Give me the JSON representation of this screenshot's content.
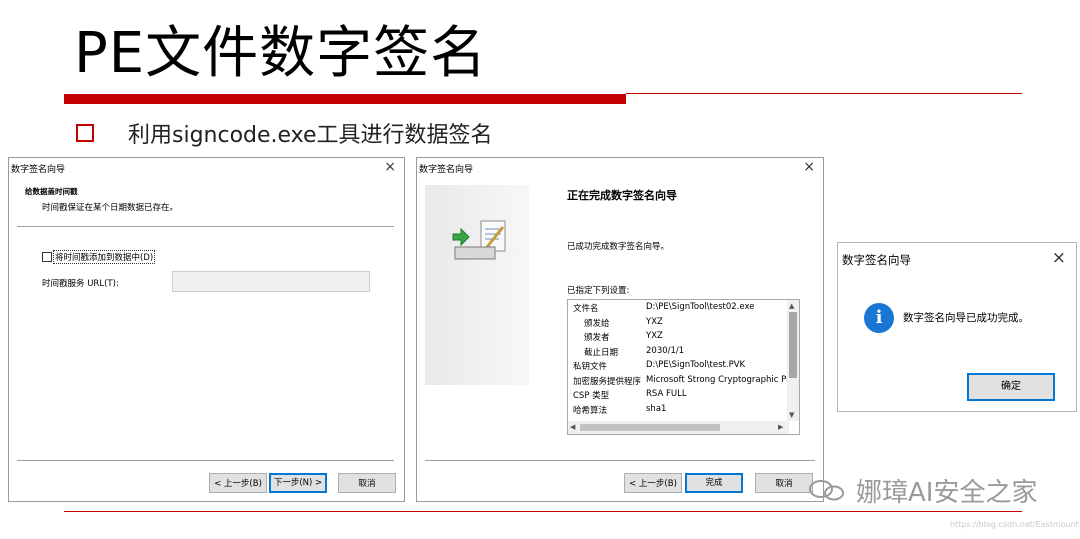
{
  "slide": {
    "title": "PE文件数字签名",
    "bullet": "利用signcode.exe工具进行数据签名"
  },
  "colors": {
    "accent": "#c40000",
    "focus": "#0078d7",
    "info": "#1976d2"
  },
  "window1": {
    "title": "数字签名向导",
    "close": "×",
    "header_bold": "给数据盖时间戳",
    "header_sub": "时间戳保证在某个日期数据已存在。",
    "checkbox_label": "将时间戳添加到数据中(D)",
    "checkbox_checked": false,
    "url_label": "时间戳服务 URL(T):",
    "url_value": "",
    "buttons": {
      "back": "< 上一步(B)",
      "next": "下一步(N) >",
      "cancel": "取消"
    }
  },
  "window2": {
    "title": "数字签名向导",
    "close": "×",
    "heading": "正在完成数字签名向导",
    "message": "已成功完成数字签名向导。",
    "settings_label": "已指定下列设置:",
    "settings": [
      {
        "key": "文件名",
        "value": "D:\\PE\\SignTool\\test02.exe",
        "indent": false
      },
      {
        "key": "颁发给",
        "value": "YXZ",
        "indent": true
      },
      {
        "key": "颁发者",
        "value": "YXZ",
        "indent": true
      },
      {
        "key": "截止日期",
        "value": "2030/1/1",
        "indent": true
      },
      {
        "key": "私钥文件",
        "value": "D:\\PE\\SignTool\\test.PVK",
        "indent": false
      },
      {
        "key": "加密服务提供程序",
        "value": "Microsoft Strong Cryptographic Pr",
        "indent": false
      },
      {
        "key": "CSP 类型",
        "value": "RSA FULL",
        "indent": false
      },
      {
        "key": "哈希算法",
        "value": "sha1",
        "indent": false
      }
    ],
    "buttons": {
      "back": "< 上一步(B)",
      "finish": "完成",
      "cancel": "取消"
    }
  },
  "window3": {
    "title": "数字签名向导",
    "close": "×",
    "icon_glyph": "i",
    "message": "数字签名向导已成功完成。",
    "ok": "确定"
  },
  "watermark": {
    "text": "娜璋AI安全之家",
    "icon": "wechat-icon",
    "url": "https://blog.csdn.net/Eastmount"
  }
}
